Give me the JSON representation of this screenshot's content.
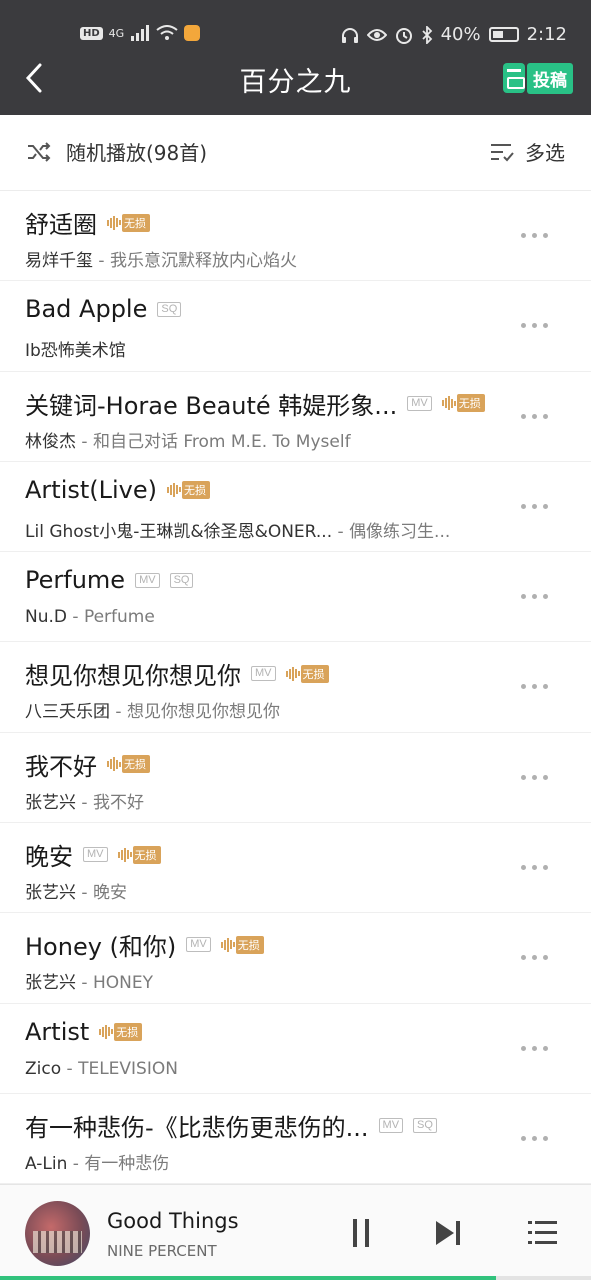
{
  "status_bar": {
    "network": "HD",
    "signal": "4G",
    "battery": "40%",
    "time": "2:12"
  },
  "header": {
    "title": "百分之九",
    "submit_label": "投稿"
  },
  "toolbar": {
    "shuffle_label": "随机播放(98首)",
    "multi_select_label": "多选"
  },
  "tag_labels": {
    "lossless": "无损",
    "mv": "MV",
    "sq": "SQ"
  },
  "songs": [
    {
      "title": "舒适圈",
      "artist": "易烊千玺",
      "album": "我乐意沉默释放内心焰火",
      "tags": [
        "lossless"
      ]
    },
    {
      "title": "Bad Apple",
      "artist": "Ib恐怖美术馆",
      "album": "",
      "tags": [
        "sq"
      ]
    },
    {
      "title": "关键词-Horae Beauté 韩媞形象...",
      "artist": "林俊杰",
      "album": "和自己对话 From M.E. To Myself",
      "tags": [
        "mv",
        "lossless"
      ]
    },
    {
      "title": "Artist(Live)",
      "artist": "Lil Ghost小鬼-王琳凯&徐圣恩&ONER...",
      "album": "偶像练习生...",
      "tags": [
        "lossless"
      ]
    },
    {
      "title": "Perfume",
      "artist": "Nu.D",
      "album": "Perfume",
      "tags": [
        "mv",
        "sq"
      ]
    },
    {
      "title": "想见你想见你想见你",
      "artist": "八三夭乐团",
      "album": "想见你想见你想见你",
      "tags": [
        "mv",
        "lossless"
      ]
    },
    {
      "title": "我不好",
      "artist": "张艺兴",
      "album": "我不好",
      "tags": [
        "lossless"
      ]
    },
    {
      "title": "晚安",
      "artist": "张艺兴",
      "album": "晚安",
      "tags": [
        "mv",
        "lossless"
      ]
    },
    {
      "title": "Honey (和你)",
      "artist": "张艺兴",
      "album": "HONEY",
      "tags": [
        "mv",
        "lossless"
      ]
    },
    {
      "title": "Artist",
      "artist": "Zico",
      "album": "TELEVISION",
      "tags": [
        "lossless"
      ]
    },
    {
      "title": "有一种悲伤-《比悲伤更悲伤的...",
      "artist": "A-Lin",
      "album": "有一种悲伤",
      "tags": [
        "mv",
        "sq"
      ]
    }
  ],
  "player": {
    "title": "Good Things",
    "artist": "NINE PERCENT",
    "progress": 0.84
  },
  "colors": {
    "header_bg": "#3b3b3e",
    "accent_green": "#31c27c",
    "lossless_gold": "#d9a35a"
  }
}
